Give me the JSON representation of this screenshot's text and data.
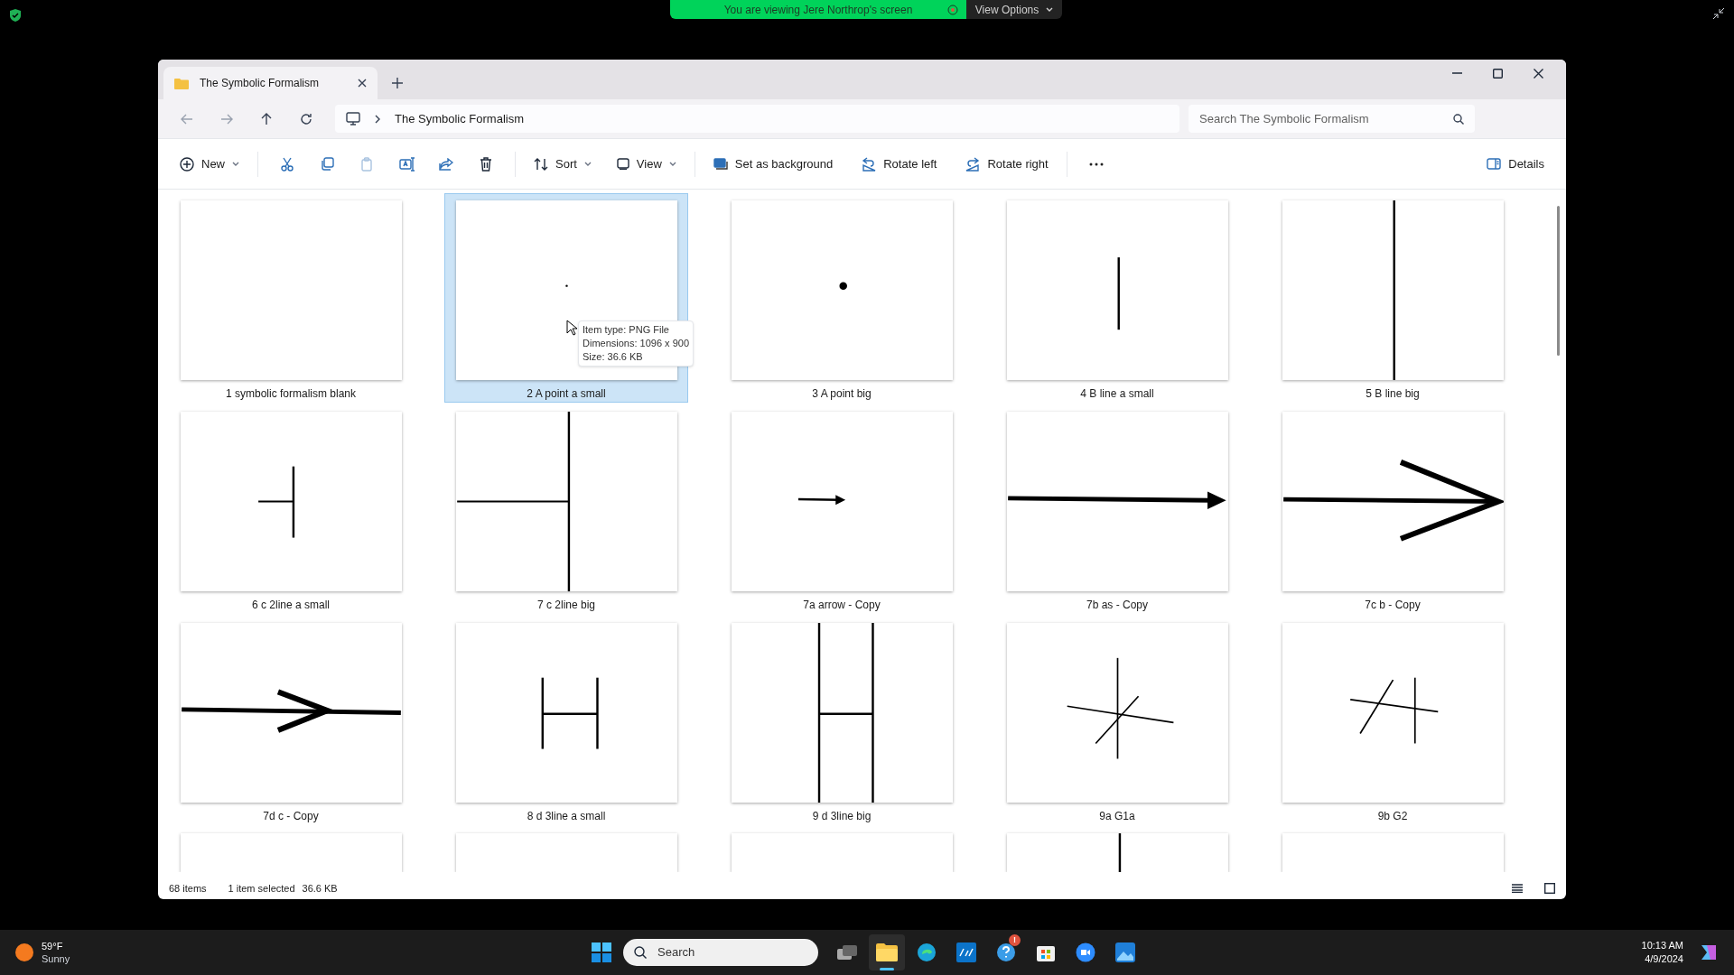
{
  "screen_share": {
    "banner": "You are viewing Jere Northrop's screen",
    "options": "View Options"
  },
  "window": {
    "tab_title": "The Symbolic Formalism",
    "address": "The Symbolic Formalism",
    "search": {
      "placeholder": "Search The Symbolic Formalism"
    }
  },
  "toolbar": {
    "new": "New",
    "sort": "Sort",
    "view": "View",
    "set_background": "Set as background",
    "rotate_left": "Rotate left",
    "rotate_right": "Rotate right",
    "details": "Details"
  },
  "files": [
    {
      "name": "1 symbolic formalism blank",
      "selected": false
    },
    {
      "name": "2 A point a small",
      "selected": true
    },
    {
      "name": "3 A point big",
      "selected": false
    },
    {
      "name": "4 B line a small",
      "selected": false
    },
    {
      "name": "5 B line big",
      "selected": false
    },
    {
      "name": "6 c 2line a small",
      "selected": false
    },
    {
      "name": "7 c 2line big",
      "selected": false
    },
    {
      "name": "7a arrow - Copy",
      "selected": false
    },
    {
      "name": "7b as - Copy",
      "selected": false
    },
    {
      "name": "7c b - Copy",
      "selected": false
    },
    {
      "name": "7d c - Copy",
      "selected": false
    },
    {
      "name": "8 d 3line a small",
      "selected": false
    },
    {
      "name": "9 d 3line big",
      "selected": false
    },
    {
      "name": "9a G1a",
      "selected": false
    },
    {
      "name": "9b G2",
      "selected": false
    }
  ],
  "tooltip": [
    "Item type: PNG File",
    "Dimensions: 1096 x 900",
    "Size: 36.6 KB"
  ],
  "status_bar": {
    "count": "68 items",
    "selection": "1 item selected",
    "size": "36.6 KB"
  },
  "taskbar": {
    "temperature": "59°F",
    "weather": "Sunny",
    "search": "Search",
    "badge": "!",
    "time": "10:13 AM",
    "date": "4/9/2024"
  }
}
